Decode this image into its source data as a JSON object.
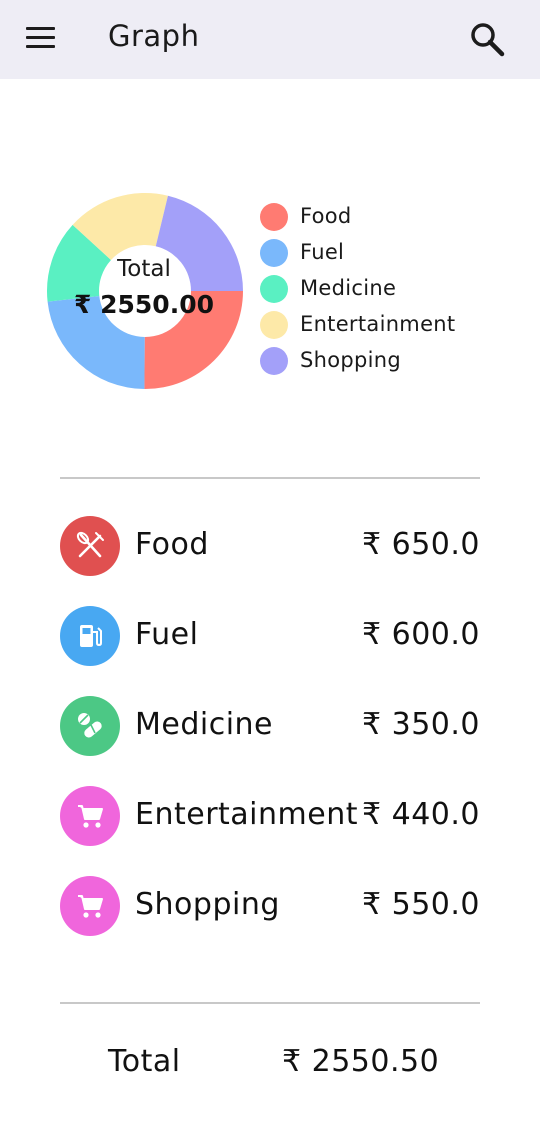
{
  "appbar": {
    "title": "Graph",
    "menu_icon": "hamburger-menu-icon",
    "search_icon": "search-icon"
  },
  "chart": {
    "center_label": "Total",
    "center_value": "₹ 2550.00"
  },
  "chart_data": {
    "type": "pie",
    "categories": [
      "Food",
      "Fuel",
      "Medicine",
      "Entertainment",
      "Shopping"
    ],
    "values": [
      650,
      600,
      350,
      440,
      550
    ],
    "colors": [
      "#ff7b72",
      "#7ab8fb",
      "#5af0c2",
      "#fde9a8",
      "#a3a0f9"
    ]
  },
  "legend": [
    {
      "label": "Food",
      "color": "#ff7b72"
    },
    {
      "label": "Fuel",
      "color": "#7ab8fb"
    },
    {
      "label": "Medicine",
      "color": "#5af0c2"
    },
    {
      "label": "Entertainment",
      "color": "#fde9a8"
    },
    {
      "label": "Shopping",
      "color": "#a3a0f9"
    }
  ],
  "rows": [
    {
      "label": "Food",
      "amount": "₹ 650.0",
      "icon": "fork-knife-icon",
      "color": "#e05050"
    },
    {
      "label": "Fuel",
      "amount": "₹ 600.0",
      "icon": "fuel-pump-icon",
      "color": "#48a8f2"
    },
    {
      "label": "Medicine",
      "amount": "₹ 350.0",
      "icon": "pill-icon",
      "color": "#4cc885"
    },
    {
      "label": "Entertainment",
      "amount": "₹ 440.0",
      "icon": "cart-icon",
      "color": "#f066dc"
    },
    {
      "label": "Shopping",
      "amount": "₹ 550.0",
      "icon": "cart-icon",
      "color": "#f066dc"
    }
  ],
  "footer": {
    "total_label": "Total",
    "total_value": "₹ 2550.50"
  }
}
